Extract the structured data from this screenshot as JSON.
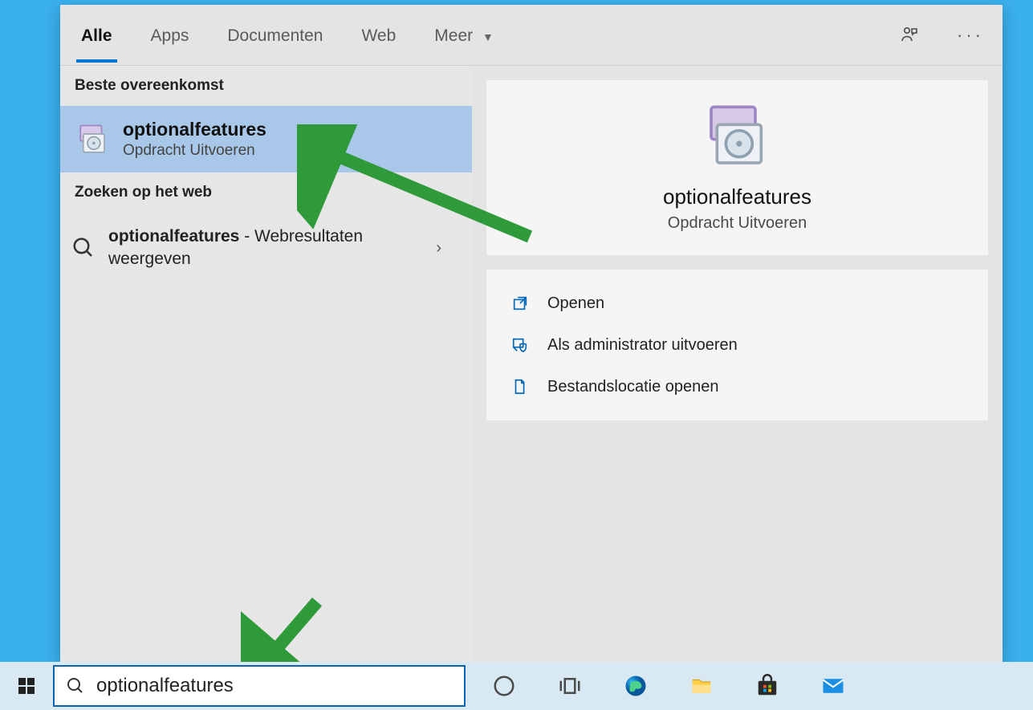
{
  "tabs": {
    "all": "Alle",
    "apps": "Apps",
    "documents": "Documenten",
    "web": "Web",
    "more": "Meer"
  },
  "sections": {
    "best_match": "Beste overeenkomst",
    "search_web": "Zoeken op het web"
  },
  "results": {
    "best_match": {
      "title": "optionalfeatures",
      "subtitle": "Opdracht Uitvoeren"
    },
    "web": {
      "query": "optionalfeatures",
      "suffix": " - Webresultaten weergeven"
    }
  },
  "detail": {
    "title": "optionalfeatures",
    "subtitle": "Opdracht Uitvoeren",
    "actions": {
      "open": "Openen",
      "admin": "Als administrator uitvoeren",
      "location": "Bestandslocatie openen"
    }
  },
  "search": {
    "value": "optionalfeatures"
  }
}
